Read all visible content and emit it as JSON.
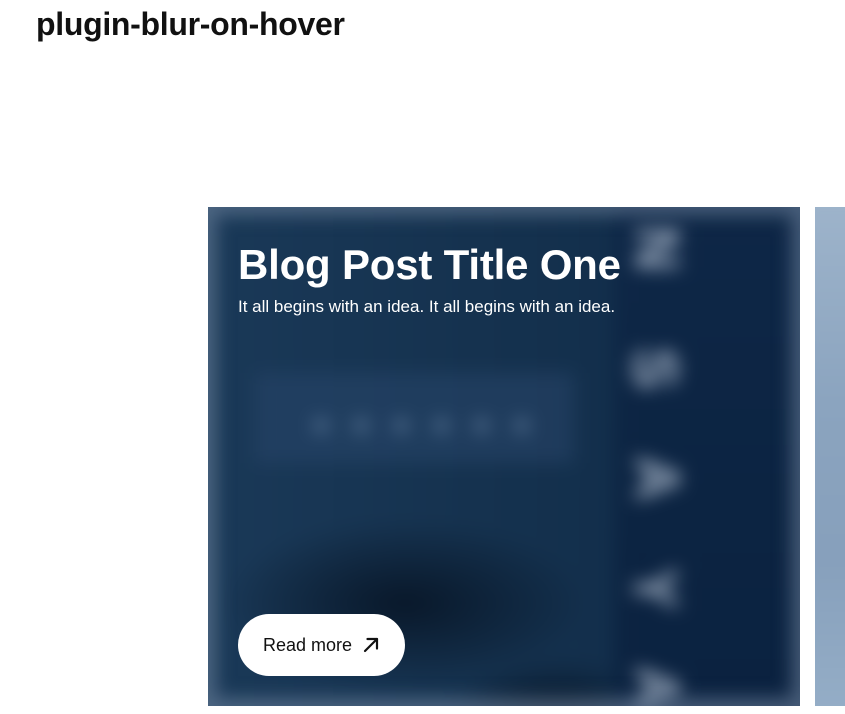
{
  "page": {
    "title": "plugin-blur-on-hover"
  },
  "cards": [
    {
      "title": "Blog Post Title One",
      "excerpt": "It all begins with an idea. It all begins with an idea.",
      "button_label": "Read more",
      "button_icon": "arrow-up-right-icon"
    }
  ],
  "colors": {
    "card_overlay": "#0f2b4a",
    "next_card": "#8ea6c0",
    "button_bg": "#ffffff",
    "button_text": "#111111"
  }
}
